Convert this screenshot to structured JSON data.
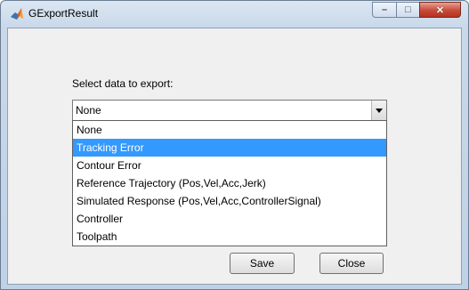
{
  "window": {
    "title": "GExportResult",
    "controls": {
      "minimize": "–",
      "maximize": "□",
      "close": "✕"
    }
  },
  "form": {
    "label": "Select data to export:",
    "select": {
      "current_value": "None",
      "options": [
        "None",
        "Tracking Error",
        "Contour Error",
        "Reference Trajectory (Pos,Vel,Acc,Jerk)",
        "Simulated Response (Pos,Vel,Acc,ControllerSignal)",
        "Controller",
        "Toolpath"
      ],
      "highlighted_index": 1
    }
  },
  "buttons": {
    "save_label": "Save",
    "close_label": "Close"
  },
  "colors": {
    "highlight": "#3399ff",
    "close_button": "#c74a38"
  }
}
